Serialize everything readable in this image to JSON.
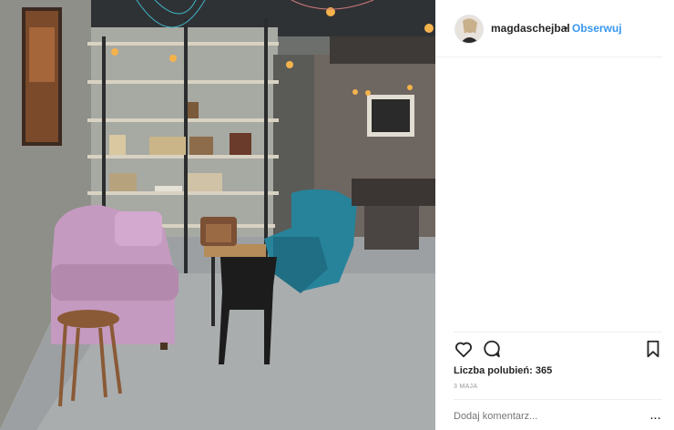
{
  "post": {
    "username": "magdaschejbal",
    "separator": "•",
    "follow_label": "Obserwuj",
    "likes_text": "Liczba polubień: 365",
    "date": "3 MAJA",
    "comment_placeholder": "Dodaj komentarz...",
    "more_label": "..."
  },
  "icons": {
    "like": "heart-icon",
    "comment": "comment-icon",
    "save": "bookmark-icon",
    "options": "more-options-icon"
  },
  "colors": {
    "link": "#3897f0",
    "text": "#262626",
    "muted": "#999999",
    "divider": "#efefef"
  }
}
